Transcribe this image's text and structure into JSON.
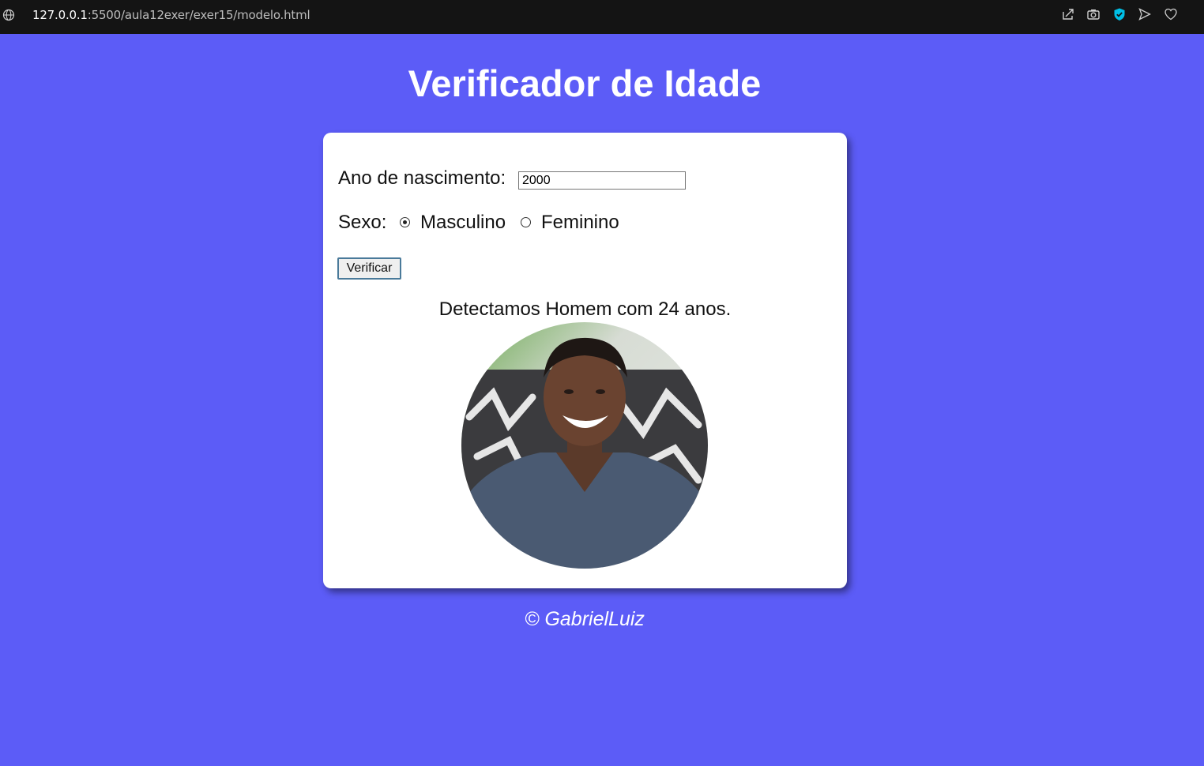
{
  "browser": {
    "url_host": "127.0.0.1",
    "url_rest": ":5500/aula12exer/exer15/modelo.html",
    "icons": [
      "globe-icon",
      "share-icon",
      "camera-icon",
      "shield-icon",
      "send-icon",
      "heart-icon"
    ],
    "accent": "#00bfe6"
  },
  "page": {
    "title": "Verificador de Idade",
    "background": "#5c5cf7"
  },
  "form": {
    "year_label": "Ano de nascimento:",
    "year_value": "2000",
    "sex_label": "Sexo:",
    "option_male": "Masculino",
    "option_female": "Feminino",
    "selected": "Masculino",
    "button_label": "Verificar"
  },
  "result": {
    "text": "Detectamos Homem com 24 anos."
  },
  "footer": {
    "text": "© GabrielLuiz"
  }
}
